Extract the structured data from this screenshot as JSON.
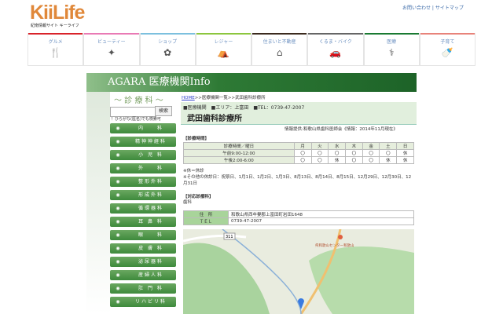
{
  "header": {
    "logo": "KiiLife",
    "tagline": "紀南情報サイト キーライフ",
    "links": "お問い合わせ | サイトマップ"
  },
  "nav": [
    {
      "label": "グルメ",
      "icon": "🍴",
      "color": "#d9232a"
    },
    {
      "label": "ビューティー",
      "icon": "✦",
      "color": "#e97ab5"
    },
    {
      "label": "ショップ",
      "icon": "✿",
      "color": "#7cc0de"
    },
    {
      "label": "レジャー",
      "icon": "⛺",
      "color": "#8cc63e"
    },
    {
      "label": "住まいと不動産",
      "icon": "⌂",
      "color": "#3b2a1e"
    },
    {
      "label": "くるま・バイク",
      "icon": "🚗",
      "color": "#666666"
    },
    {
      "label": "医療",
      "icon": "⚕",
      "color": "#1a7a32"
    },
    {
      "label": "子育て",
      "icon": "🍼",
      "color": "#e8837a"
    }
  ],
  "banner": {
    "title": "AGARA 医療機関Info"
  },
  "sidebar": {
    "title": "～ 診 療 科 ～",
    "search_button": "検索",
    "hint": "！ひらがな(医名)でも検索可",
    "items": [
      "内　　科",
      "精神神経科",
      "小 児 科",
      "外　　科",
      "整形外科",
      "形成外科",
      "循環器科",
      "耳 鼻 科",
      "眼　　科",
      "皮 膚 科",
      "泌尿器科",
      "産婦人科",
      "肛 門 科",
      "リハビリ科"
    ]
  },
  "breadcrumb": {
    "home": "HOME",
    "rest": ">>医療機関一覧>>武田歯科診療所"
  },
  "clinic": {
    "meta": "■医療機関　■エリア：上富田　■TEL：0739-47-2007",
    "name": "武田歯科診療所",
    "credit": "情報提供:和歌山県歯科医師会《情報：2014年11月現在》"
  },
  "hours": {
    "title": "【診療時間】",
    "headers": [
      "診療時間／曜日",
      "月",
      "火",
      "水",
      "木",
      "金",
      "土",
      "日"
    ],
    "rows": [
      [
        "午前9:00-12:00",
        "〇",
        "〇",
        "〇",
        "〇",
        "〇",
        "〇",
        "休"
      ],
      [
        "午後2:00-6:00",
        "〇",
        "〇",
        "休",
        "〇",
        "〇",
        "休",
        "休"
      ]
    ],
    "note1": "※休＝休診",
    "note2": "※その他の休診日：祝祭日、1月1日、1月2日、1月3日、8月13日、8月14日、8月15日、12月29日、12月30日、12月31日"
  },
  "departments": {
    "title": "【対応診療科】",
    "value": "歯科"
  },
  "info": [
    {
      "label": "住　所",
      "value": "和歌山県西牟婁郡上富田町岩田1648"
    },
    {
      "label": "ＴＥＬ",
      "value": "0739-47-2007"
    }
  ],
  "map": {
    "road": "311",
    "poi": "県和歌山センター和歌山"
  }
}
